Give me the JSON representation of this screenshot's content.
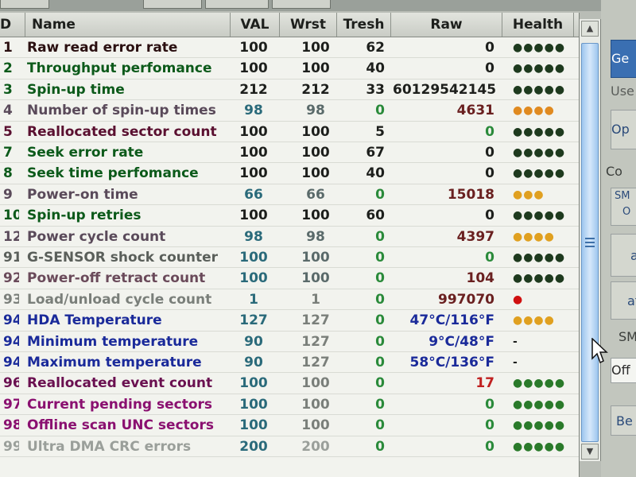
{
  "columns": {
    "id": "D",
    "name": "Name",
    "val": "VAL",
    "wrst": "Wrst",
    "tresh": "Tresh",
    "raw": "Raw",
    "health": "Health"
  },
  "rows": [
    {
      "id": "1",
      "name": "Raw read error rate",
      "val": "100",
      "wrst": "100",
      "tresh": "62",
      "raw": "0",
      "health": "●●●●●",
      "name_color": "#2a0f10",
      "val_color": "#1d1f1c",
      "wrst_color": "#1d1f1c",
      "tresh_color": "#1d1f1c",
      "raw_color": "#1d1f1c",
      "health_color": "#1e3a1e"
    },
    {
      "id": "2",
      "name": "Throughput perfomance",
      "val": "100",
      "wrst": "100",
      "tresh": "40",
      "raw": "0",
      "health": "●●●●●",
      "name_color": "#0c5a1a",
      "val_color": "#1d1f1c",
      "wrst_color": "#1d1f1c",
      "tresh_color": "#1d1f1c",
      "raw_color": "#1d1f1c",
      "health_color": "#1e3a1e"
    },
    {
      "id": "3",
      "name": "Spin-up time",
      "val": "212",
      "wrst": "212",
      "tresh": "33",
      "raw": "60129542145",
      "health": "●●●●●",
      "name_color": "#0c5a1a",
      "val_color": "#1d1f1c",
      "wrst_color": "#1d1f1c",
      "tresh_color": "#1d1f1c",
      "raw_color": "#1d1f1c",
      "health_color": "#1e3a1e"
    },
    {
      "id": "4",
      "name": "Number of spin-up times",
      "val": "98",
      "wrst": "98",
      "tresh": "0",
      "raw": "4631",
      "health": "●●●●",
      "name_color": "#5a4a5a",
      "val_color": "#2a6a7a",
      "wrst_color": "#5a6a6a",
      "tresh_color": "#2a8a3a",
      "raw_color": "#6a2020",
      "health_color": "#e08a20"
    },
    {
      "id": "5",
      "name": "Reallocated sector count",
      "val": "100",
      "wrst": "100",
      "tresh": "5",
      "raw": "0",
      "health": "●●●●●",
      "name_color": "#5a1030",
      "val_color": "#1d1f1c",
      "wrst_color": "#1d1f1c",
      "tresh_color": "#1d1f1c",
      "raw_color": "#2a8a3a",
      "health_color": "#1e3a1e"
    },
    {
      "id": "7",
      "name": "Seek error rate",
      "val": "100",
      "wrst": "100",
      "tresh": "67",
      "raw": "0",
      "health": "●●●●●",
      "name_color": "#0c5a1a",
      "val_color": "#1d1f1c",
      "wrst_color": "#1d1f1c",
      "tresh_color": "#1d1f1c",
      "raw_color": "#1d1f1c",
      "health_color": "#1e3a1e"
    },
    {
      "id": "8",
      "name": "Seek time perfomance",
      "val": "100",
      "wrst": "100",
      "tresh": "40",
      "raw": "0",
      "health": "●●●●●",
      "name_color": "#0c5a1a",
      "val_color": "#1d1f1c",
      "wrst_color": "#1d1f1c",
      "tresh_color": "#1d1f1c",
      "raw_color": "#1d1f1c",
      "health_color": "#1e3a1e"
    },
    {
      "id": "9",
      "name": "Power-on time",
      "val": "66",
      "wrst": "66",
      "tresh": "0",
      "raw": "15018",
      "health": "●●●",
      "name_color": "#5a4a5a",
      "val_color": "#2a6a7a",
      "wrst_color": "#5a6a6a",
      "tresh_color": "#2a8a3a",
      "raw_color": "#6a2020",
      "health_color": "#e0a020"
    },
    {
      "id": "10",
      "name": "Spin-up retries",
      "val": "100",
      "wrst": "100",
      "tresh": "60",
      "raw": "0",
      "health": "●●●●●",
      "name_color": "#0c5a1a",
      "val_color": "#1d1f1c",
      "wrst_color": "#1d1f1c",
      "tresh_color": "#1d1f1c",
      "raw_color": "#1d1f1c",
      "health_color": "#1e3a1e"
    },
    {
      "id": "12",
      "name": "Power cycle count",
      "val": "98",
      "wrst": "98",
      "tresh": "0",
      "raw": "4397",
      "health": "●●●●",
      "name_color": "#5a4a5a",
      "val_color": "#2a6a7a",
      "wrst_color": "#5a6a6a",
      "tresh_color": "#2a8a3a",
      "raw_color": "#6a2020",
      "health_color": "#e0a020"
    },
    {
      "id": "91",
      "name": "G-SENSOR shock counter",
      "val": "100",
      "wrst": "100",
      "tresh": "0",
      "raw": "0",
      "health": "●●●●●",
      "name_color": "#5a5f5a",
      "val_color": "#2a6a7a",
      "wrst_color": "#5a6a6a",
      "tresh_color": "#2a8a3a",
      "raw_color": "#2a8a3a",
      "health_color": "#1e3a1e"
    },
    {
      "id": "92",
      "name": "Power-off retract count",
      "val": "100",
      "wrst": "100",
      "tresh": "0",
      "raw": "104",
      "health": "●●●●●",
      "name_color": "#6a4a5a",
      "val_color": "#2a6a7a",
      "wrst_color": "#5a6a6a",
      "tresh_color": "#2a8a3a",
      "raw_color": "#6a2020",
      "health_color": "#1e3a1e"
    },
    {
      "id": "93",
      "name": "Load/unload cycle count",
      "val": "1",
      "wrst": "1",
      "tresh": "0",
      "raw": "997070",
      "health": "●",
      "name_color": "#7a7f7a",
      "val_color": "#2a6a7a",
      "wrst_color": "#7a7f7a",
      "tresh_color": "#2a8a3a",
      "raw_color": "#6a2020",
      "health_color": "#d01010"
    },
    {
      "id": "94",
      "name": "HDA Temperature",
      "val": "127",
      "wrst": "127",
      "tresh": "0",
      "raw": "47°C/116°F",
      "health": "●●●●",
      "name_color": "#1a2a9a",
      "val_color": "#2a6a7a",
      "wrst_color": "#7a7f7a",
      "tresh_color": "#2a8a3a",
      "raw_color": "#1a2a9a",
      "health_color": "#e0a020"
    },
    {
      "id": "94",
      "name": "Minimum temperature",
      "val": "90",
      "wrst": "127",
      "tresh": "0",
      "raw": "9°C/48°F",
      "health": "-",
      "name_color": "#1a2a9a",
      "val_color": "#2a6a7a",
      "wrst_color": "#7a7f7a",
      "tresh_color": "#2a8a3a",
      "raw_color": "#1a2a9a",
      "health_color": "#1d1f1c"
    },
    {
      "id": "94",
      "name": "Maximum temperature",
      "val": "90",
      "wrst": "127",
      "tresh": "0",
      "raw": "58°C/136°F",
      "health": "-",
      "name_color": "#1a2a9a",
      "val_color": "#2a6a7a",
      "wrst_color": "#7a7f7a",
      "tresh_color": "#2a8a3a",
      "raw_color": "#1a2a9a",
      "health_color": "#1d1f1c"
    },
    {
      "id": "96",
      "name": "Reallocated event count",
      "val": "100",
      "wrst": "100",
      "tresh": "0",
      "raw": "17",
      "health": "●●●●●",
      "name_color": "#6a1050",
      "val_color": "#2a6a7a",
      "wrst_color": "#7a7f7a",
      "tresh_color": "#2a8a3a",
      "raw_color": "#c02020",
      "health_color": "#2a7a2a"
    },
    {
      "id": "97",
      "name": "Current pending sectors",
      "val": "100",
      "wrst": "100",
      "tresh": "0",
      "raw": "0",
      "health": "●●●●●",
      "name_color": "#8a1070",
      "val_color": "#2a6a7a",
      "wrst_color": "#7a7f7a",
      "tresh_color": "#2a8a3a",
      "raw_color": "#2a8a3a",
      "health_color": "#2a7a2a"
    },
    {
      "id": "98",
      "name": "Offline scan UNC sectors",
      "val": "100",
      "wrst": "100",
      "tresh": "0",
      "raw": "0",
      "health": "●●●●●",
      "name_color": "#8a1070",
      "val_color": "#2a6a7a",
      "wrst_color": "#7a7f7a",
      "tresh_color": "#2a8a3a",
      "raw_color": "#2a8a3a",
      "health_color": "#2a7a2a"
    },
    {
      "id": "99",
      "name": "Ultra DMA CRC errors",
      "val": "200",
      "wrst": "200",
      "tresh": "0",
      "raw": "0",
      "health": "●●●●●",
      "name_color": "#9a9f9a",
      "val_color": "#2a6a7a",
      "wrst_color": "#9a9f9a",
      "tresh_color": "#2a8a3a",
      "raw_color": "#2a8a3a",
      "health_color": "#2a7a2a"
    }
  ],
  "side": {
    "btn_top": "Ge",
    "label_use": "Use",
    "btn_op": "Op",
    "group_co": "Co",
    "btn_sm": "SM",
    "btn_sm_sub": "O",
    "btn_a": "a",
    "btn_at": "at",
    "group_sm": "SM",
    "select_off": "Off",
    "btn_be": "Be"
  }
}
